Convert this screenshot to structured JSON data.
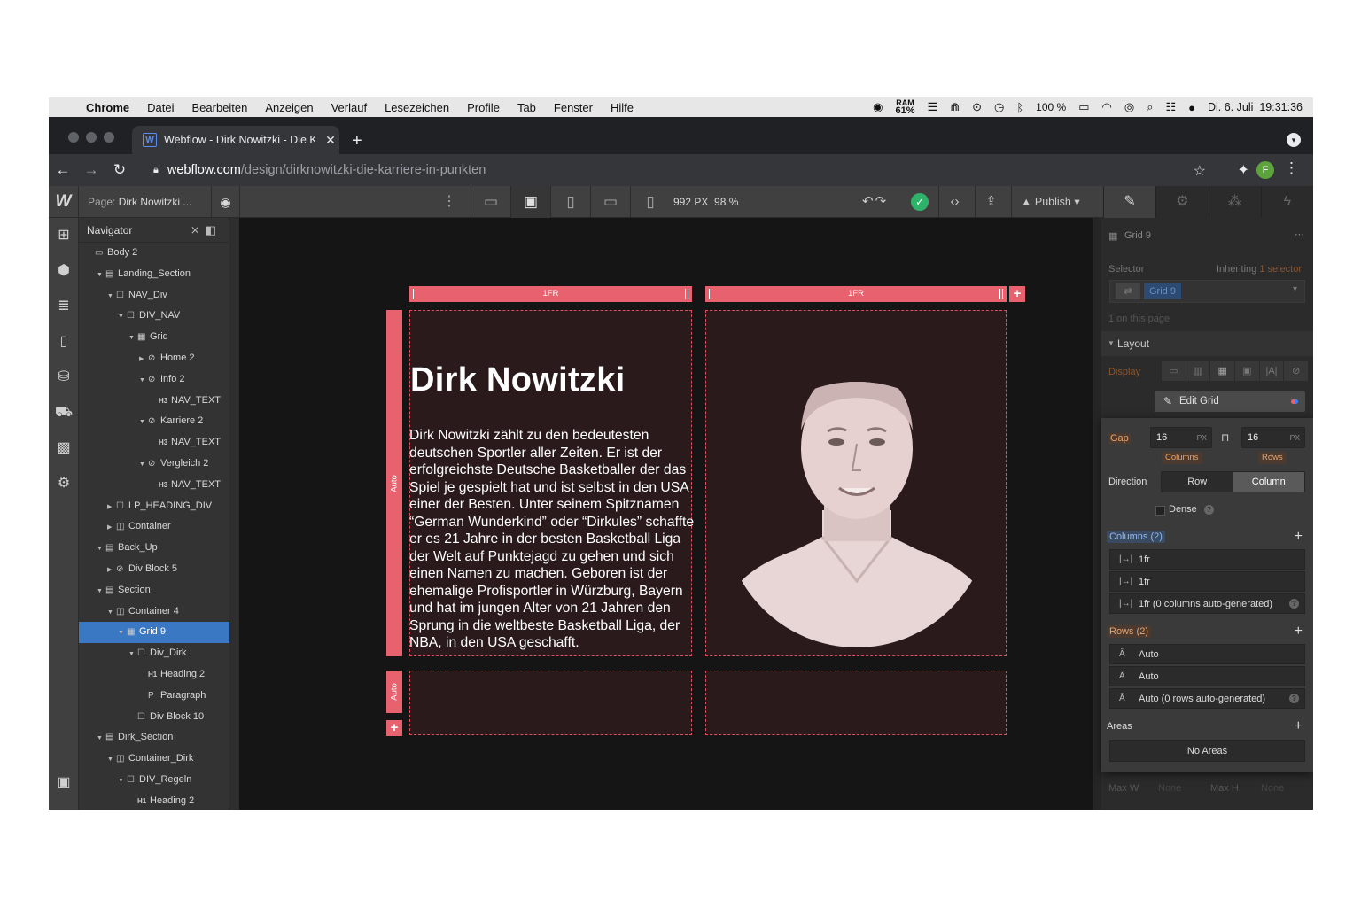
{
  "menubar": {
    "app": "Chrome",
    "items": [
      "Datei",
      "Bearbeiten",
      "Anzeigen",
      "Verlauf",
      "Lesezeichen",
      "Profile",
      "Tab",
      "Fenster",
      "Hilfe"
    ],
    "ram_label": "RAM",
    "ram_value": "61%",
    "battery": "100 %",
    "datetime": "Di. 6. Juli  19:31:36"
  },
  "browser": {
    "tab_title": "Webflow - Dirk Nowitzki - Die Karriere in Punkten",
    "url_host": "webflow.com",
    "url_path": "/design/dirknowitzki-die-karriere-in-punkten",
    "profile_initial": "F"
  },
  "webflow": {
    "page_label": "Page:",
    "page_name": "Dirk Nowitzki ...",
    "canvas_width": "992 PX",
    "zoom": "98 %",
    "publish": "Publish"
  },
  "navigator": {
    "title": "Navigator",
    "nodes": [
      {
        "label": "Body 2",
        "icon": "body-icon",
        "glyph": "▭",
        "depth": 0,
        "caret": ""
      },
      {
        "label": "Landing_Section",
        "icon": "section-icon",
        "glyph": "▤",
        "depth": 1,
        "caret": "▼"
      },
      {
        "label": "NAV_Div",
        "icon": "div-icon",
        "glyph": "☐",
        "depth": 2,
        "caret": "▼"
      },
      {
        "label": "DIV_NAV",
        "icon": "div-icon",
        "glyph": "☐",
        "depth": 3,
        "caret": "▼"
      },
      {
        "label": "Grid",
        "icon": "grid-icon",
        "glyph": "▦",
        "depth": 4,
        "caret": "▼"
      },
      {
        "label": "Home 2",
        "icon": "link-icon",
        "glyph": "⊘",
        "depth": 5,
        "caret": "▶"
      },
      {
        "label": "Info 2",
        "icon": "link-icon",
        "glyph": "⊘",
        "depth": 5,
        "caret": "▼"
      },
      {
        "label": "NAV_TEXT",
        "icon": "heading-icon",
        "glyph": "H3",
        "depth": 6,
        "caret": ""
      },
      {
        "label": "Karriere 2",
        "icon": "link-icon",
        "glyph": "⊘",
        "depth": 5,
        "caret": "▼"
      },
      {
        "label": "NAV_TEXT",
        "icon": "heading-icon",
        "glyph": "H3",
        "depth": 6,
        "caret": ""
      },
      {
        "label": "Vergleich 2",
        "icon": "link-icon",
        "glyph": "⊘",
        "depth": 5,
        "caret": "▼"
      },
      {
        "label": "NAV_TEXT",
        "icon": "heading-icon",
        "glyph": "H3",
        "depth": 6,
        "caret": ""
      },
      {
        "label": "LP_HEADING_DIV",
        "icon": "div-icon",
        "glyph": "☐",
        "depth": 2,
        "caret": "▶"
      },
      {
        "label": "Container",
        "icon": "container-icon",
        "glyph": "◫",
        "depth": 2,
        "caret": "▶"
      },
      {
        "label": "Back_Up",
        "icon": "section-icon",
        "glyph": "▤",
        "depth": 1,
        "caret": "▼"
      },
      {
        "label": "Div Block 5",
        "icon": "link-icon",
        "glyph": "⊘",
        "depth": 2,
        "caret": "▶"
      },
      {
        "label": "Section",
        "icon": "section-icon",
        "glyph": "▤",
        "depth": 1,
        "caret": "▼"
      },
      {
        "label": "Container 4",
        "icon": "container-icon",
        "glyph": "◫",
        "depth": 2,
        "caret": "▼"
      },
      {
        "label": "Grid 9",
        "icon": "grid-icon",
        "glyph": "▦",
        "depth": 3,
        "caret": "▼",
        "selected": true
      },
      {
        "label": "Div_Dirk",
        "icon": "div-icon",
        "glyph": "☐",
        "depth": 4,
        "caret": "▼"
      },
      {
        "label": "Heading 2",
        "icon": "heading-icon",
        "glyph": "H1",
        "depth": 5,
        "caret": ""
      },
      {
        "label": "Paragraph",
        "icon": "paragraph-icon",
        "glyph": "P",
        "depth": 5,
        "caret": ""
      },
      {
        "label": "Div Block 10",
        "icon": "div-icon",
        "glyph": "☐",
        "depth": 4,
        "caret": ""
      },
      {
        "label": "Dirk_Section",
        "icon": "section-icon",
        "glyph": "▤",
        "depth": 1,
        "caret": "▼"
      },
      {
        "label": "Container_Dirk",
        "icon": "container-icon",
        "glyph": "◫",
        "depth": 2,
        "caret": "▼"
      },
      {
        "label": "DIV_Regeln",
        "icon": "div-icon",
        "glyph": "☐",
        "depth": 3,
        "caret": "▼"
      },
      {
        "label": "Heading 2",
        "icon": "heading-icon",
        "glyph": "H1",
        "depth": 4,
        "caret": ""
      }
    ]
  },
  "canvas": {
    "col1": "1FR",
    "col2": "1FR",
    "row1": "Auto",
    "row2": "Auto",
    "heading": "Dirk Nowitzki",
    "paragraph": "Dirk Nowitzki zählt zu den bedeutesten deutschen Sportler aller Zeiten. Er ist der erfolgreichste Deutsche Basketballer der das Spiel je gespielt hat und ist selbst in den USA einer der Besten. Unter seinem Spitznamen “German Wunderkind” oder “Dirkules” schaffte er es 21 Jahre in der besten Basketball Liga der Welt auf Punktejagd zu gehen und sich einen Namen zu machen. Geboren ist der ehemalige Profisportler in Würzburg, Bayern und hat im jungen Alter von 21 Jahren den Sprung in die weltbeste Basketball Liga, der NBA, in den USA geschafft."
  },
  "style_panel": {
    "element": "Grid 9",
    "selector_label": "Selector",
    "inheriting": "Inheriting",
    "inheriting_count": "1 selector",
    "selector_value": "Grid 9",
    "on_page": "1 on this page",
    "layout": "Layout",
    "display": "Display",
    "edit_grid": "Edit Grid",
    "gap_label": "Gap",
    "gap_col": "16",
    "gap_row": "16",
    "unit": "PX",
    "columns_tag": "Columns",
    "rows_tag": "Rows",
    "direction_label": "Direction",
    "dir_row": "Row",
    "dir_column": "Column",
    "dense": "Dense",
    "columns_header": "Columns (2)",
    "columns": [
      "1fr",
      "1fr",
      "1fr (0 columns auto-generated)"
    ],
    "rows_header": "Rows (2)",
    "rows": [
      "Auto",
      "Auto",
      "Auto (0 rows auto-generated)"
    ],
    "areas": "Areas",
    "no_areas": "No Areas",
    "max_w": "Max W",
    "max_h": "Max H",
    "none": "None"
  },
  "colors": {
    "accent": "#e8616e",
    "selection": "#3b78c3",
    "ok": "#2fb36a"
  }
}
